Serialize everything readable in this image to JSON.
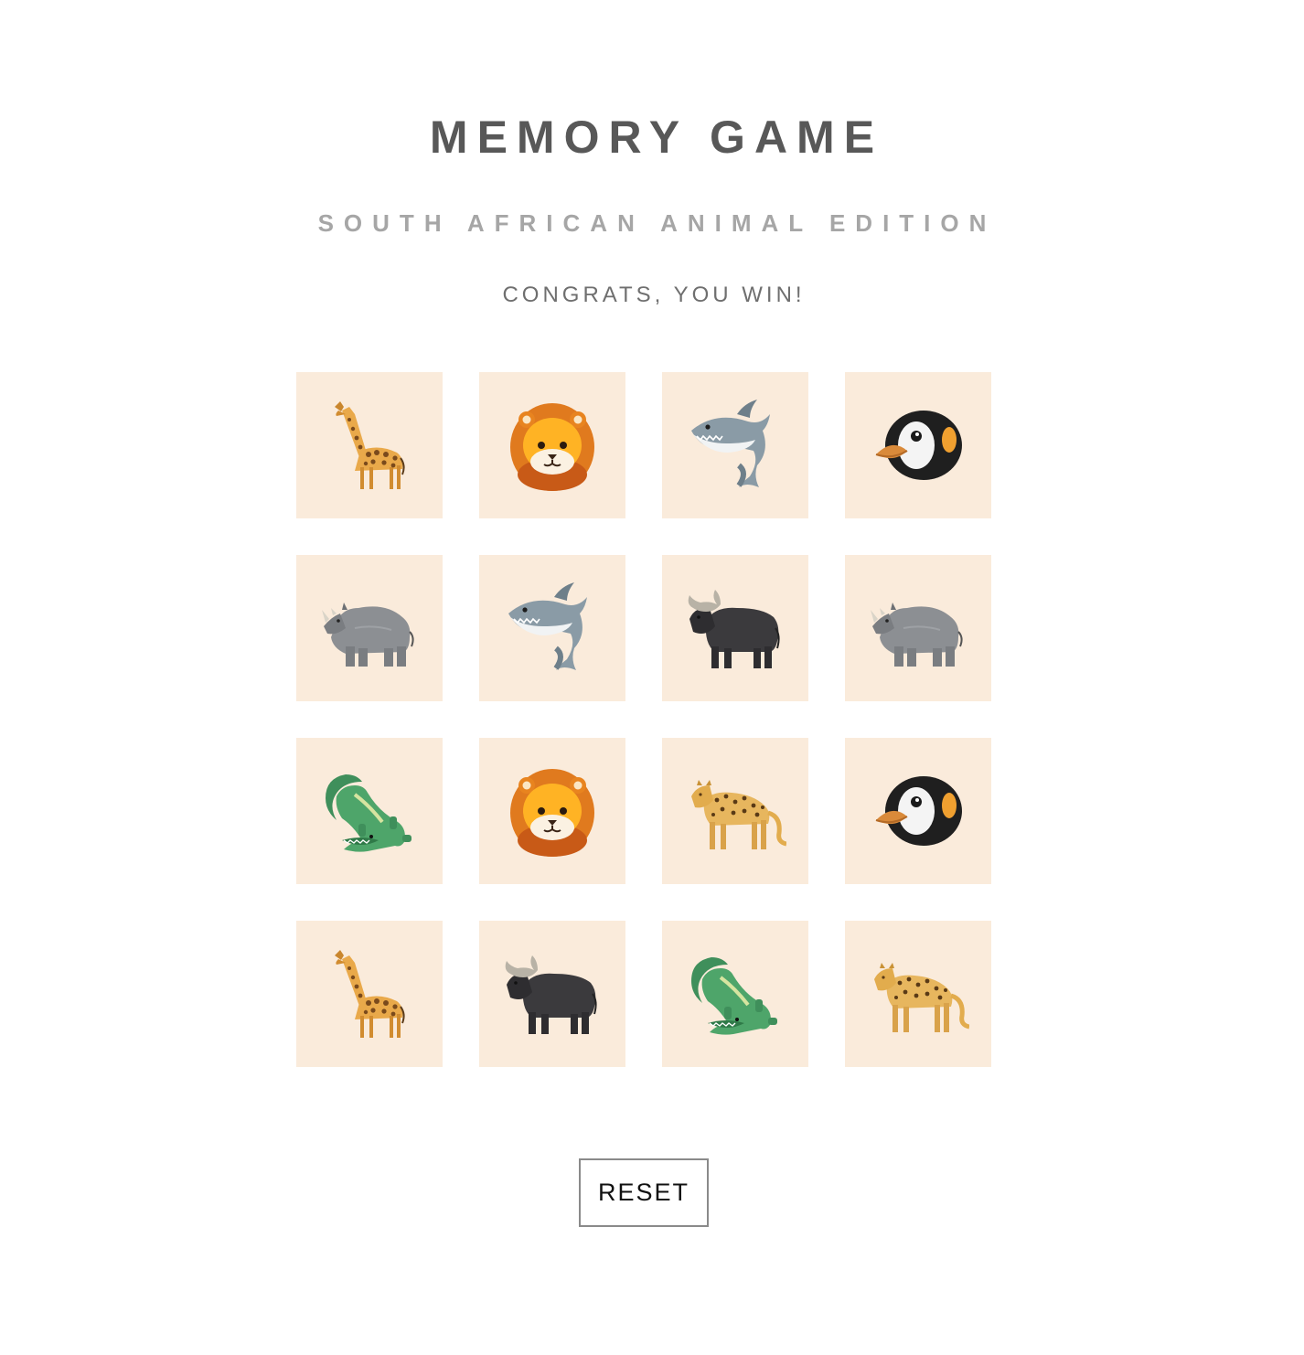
{
  "header": {
    "title": "MEMORY GAME",
    "subtitle": "SOUTH AFRICAN ANIMAL EDITION",
    "status": "CONGRATS, YOU WIN!"
  },
  "board": {
    "card_background": "#faebdb",
    "cards": [
      {
        "animal": "giraffe",
        "icon": "giraffe-icon",
        "state": "matched"
      },
      {
        "animal": "lion",
        "icon": "lion-icon",
        "state": "matched"
      },
      {
        "animal": "shark",
        "icon": "shark-icon",
        "state": "matched"
      },
      {
        "animal": "penguin",
        "icon": "penguin-icon",
        "state": "matched"
      },
      {
        "animal": "rhino",
        "icon": "rhino-icon",
        "state": "matched"
      },
      {
        "animal": "shark",
        "icon": "shark-icon",
        "state": "matched"
      },
      {
        "animal": "buffalo",
        "icon": "buffalo-icon",
        "state": "matched"
      },
      {
        "animal": "rhino",
        "icon": "rhino-icon",
        "state": "matched"
      },
      {
        "animal": "crocodile",
        "icon": "crocodile-icon",
        "state": "matched"
      },
      {
        "animal": "lion",
        "icon": "lion-icon",
        "state": "matched"
      },
      {
        "animal": "leopard",
        "icon": "leopard-icon",
        "state": "matched"
      },
      {
        "animal": "penguin",
        "icon": "penguin-icon",
        "state": "matched"
      },
      {
        "animal": "giraffe",
        "icon": "giraffe-icon",
        "state": "matched"
      },
      {
        "animal": "buffalo",
        "icon": "buffalo-icon",
        "state": "matched"
      },
      {
        "animal": "crocodile",
        "icon": "crocodile-icon",
        "state": "matched"
      },
      {
        "animal": "leopard",
        "icon": "leopard-icon",
        "state": "matched"
      }
    ]
  },
  "controls": {
    "reset_label": "RESET"
  },
  "colors": {
    "title": "#585858",
    "subtitle": "#a6a6a6",
    "status": "#6f6f6f",
    "card": "#faebdb",
    "button_border": "#8a8a8a"
  }
}
